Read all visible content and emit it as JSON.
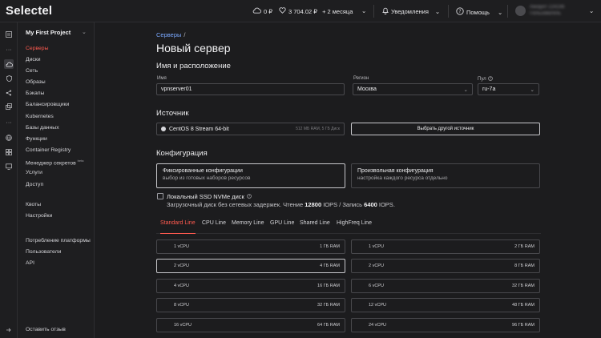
{
  "header": {
    "logo": "Selectel",
    "balance": "0 ₽",
    "bonus": "3 704.02 ₽",
    "period": "+ 2 месяца",
    "notifications": "Уведомления",
    "help": "Помощь",
    "account_name": "Аккаунт 224196",
    "account_sub": "Пользователь"
  },
  "sidebar": {
    "project": "My First Project",
    "items": [
      {
        "label": "Серверы",
        "active": true
      },
      {
        "label": "Диски"
      },
      {
        "label": "Сеть"
      },
      {
        "label": "Образы"
      },
      {
        "label": "Бэкапы"
      },
      {
        "label": "Балансировщики"
      },
      {
        "label": "Kubernetes"
      },
      {
        "label": "Базы данных"
      },
      {
        "label": "Функции"
      },
      {
        "label": "Container Registry"
      },
      {
        "label": "Менеджер секретов",
        "badge": "beta"
      },
      {
        "label": "Услуги"
      },
      {
        "label": "Доступ"
      }
    ],
    "group2": [
      {
        "label": "Квоты"
      },
      {
        "label": "Настройки"
      }
    ],
    "group3": [
      {
        "label": "Потребление платформы"
      },
      {
        "label": "Пользователи"
      },
      {
        "label": "API"
      }
    ],
    "feedback": "Оставить отзыв"
  },
  "main": {
    "breadcrumb": {
      "link": "Серверы",
      "sep": "/"
    },
    "title": "Новый сервер",
    "section_name": "Имя и расположение",
    "name_label": "Имя",
    "name_value": "vpnserver01",
    "region_label": "Регион",
    "region_value": "Москва",
    "pool_label": "Пул",
    "pool_value": "ru-7a",
    "section_source": "Источник",
    "source_value": "CentOS 8 Stream 64-bit",
    "source_meta": "512 МБ RAM, 5 ГБ Диск",
    "source_button": "Выбрать другой источник",
    "section_config": "Конфигурация",
    "config_fixed_title": "Фиксированные конфигурации",
    "config_fixed_sub": "выбор из готовых наборов ресурсов",
    "config_custom_title": "Произвольная конфигурация",
    "config_custom_sub": "настройка каждого ресурса отдельно",
    "ssd_title": "Локальный SSD NVMe диск",
    "ssd_sub_prefix": "Загрузочный диск без сетевых задержек. Чтение",
    "ssd_read": "12800",
    "ssd_mid": "IOPS / Запись",
    "ssd_write": "6400",
    "ssd_suffix": "IOPS.",
    "tabs": [
      "Standard Line",
      "CPU Line",
      "Memory Line",
      "GPU Line",
      "Shared Line",
      "HighFreq Line"
    ],
    "active_tab": 0,
    "options_left": [
      {
        "cpu": "1 vCPU",
        "ram": "1 ГБ RAM"
      },
      {
        "cpu": "2 vCPU",
        "ram": "4 ГБ RAM",
        "selected": true
      },
      {
        "cpu": "4 vCPU",
        "ram": "16 ГБ RAM"
      },
      {
        "cpu": "8 vCPU",
        "ram": "32 ГБ RAM"
      },
      {
        "cpu": "16 vCPU",
        "ram": "64 ГБ RAM"
      }
    ],
    "options_right": [
      {
        "cpu": "1 vCPU",
        "ram": "2 ГБ RAM"
      },
      {
        "cpu": "2 vCPU",
        "ram": "8 ГБ RAM"
      },
      {
        "cpu": "6 vCPU",
        "ram": "32 ГБ RAM"
      },
      {
        "cpu": "12 vCPU",
        "ram": "48 ГБ RAM"
      },
      {
        "cpu": "24 vCPU",
        "ram": "96 ГБ RAM"
      }
    ]
  },
  "colors": {
    "accent": "#ff5a4f",
    "link": "#7aa8ff",
    "background": "#1c1c1e"
  }
}
